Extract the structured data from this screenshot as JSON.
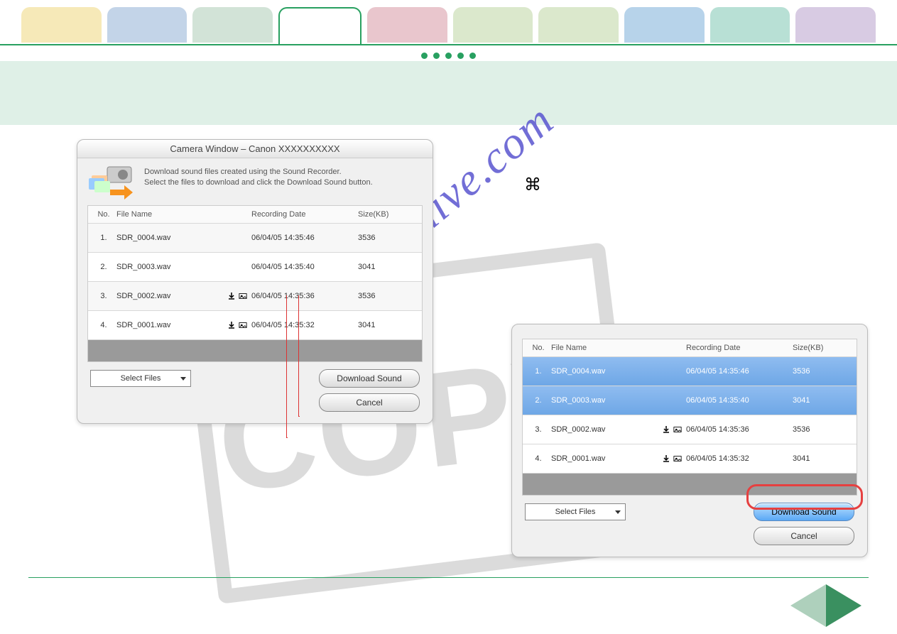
{
  "tabs": {
    "colors": [
      "#f6e9b8",
      "#c3d4e8",
      "#d2e3d7",
      "#ffffff",
      "#e9c6cd",
      "#dbe8cc",
      "#dbe8cc",
      "#b7d3ea",
      "#b8e0d5",
      "#d8cbe3"
    ],
    "activeIndex": 3
  },
  "watermark": {
    "site": "manualshive.com",
    "copy": "COPY"
  },
  "cmdSymbol": "⌘",
  "dialogLeft": {
    "title": "Camera Window – Canon XXXXXXXXXX",
    "intro_line1": "Download sound files created using the Sound Recorder.",
    "intro_line2": "Select the files to download and click the Download Sound button.",
    "columns": {
      "no": "No.",
      "fn": "File Name",
      "dt": "Recording Date",
      "sz": "Size(KB)"
    },
    "rows": [
      {
        "no": "1.",
        "fn": "SDR_0004.wav",
        "dl": false,
        "card": false,
        "dt": "06/04/05 14:35:46",
        "sz": "3536",
        "alt": true
      },
      {
        "no": "2.",
        "fn": "SDR_0003.wav",
        "dl": false,
        "card": false,
        "dt": "06/04/05 14:35:40",
        "sz": "3041",
        "alt": false
      },
      {
        "no": "3.",
        "fn": "SDR_0002.wav",
        "dl": true,
        "card": true,
        "dt": "06/04/05 14:35:36",
        "sz": "3536",
        "alt": true
      },
      {
        "no": "4.",
        "fn": "SDR_0001.wav",
        "dl": true,
        "card": true,
        "dt": "06/04/05 14:35:32",
        "sz": "3041",
        "alt": false
      }
    ],
    "selectFiles": "Select Files",
    "downloadSound": "Download Sound",
    "cancel": "Cancel"
  },
  "dialogRight": {
    "columns": {
      "no": "No.",
      "fn": "File Name",
      "dt": "Recording Date",
      "sz": "Size(KB)"
    },
    "rows": [
      {
        "no": "1.",
        "fn": "SDR_0004.wav",
        "dl": false,
        "card": false,
        "dt": "06/04/05 14:35:46",
        "sz": "3536",
        "sel": true
      },
      {
        "no": "2.",
        "fn": "SDR_0003.wav",
        "dl": false,
        "card": false,
        "dt": "06/04/05 14:35:40",
        "sz": "3041",
        "sel": true
      },
      {
        "no": "3.",
        "fn": "SDR_0002.wav",
        "dl": true,
        "card": true,
        "dt": "06/04/05 14:35:36",
        "sz": "3536",
        "sel": false
      },
      {
        "no": "4.",
        "fn": "SDR_0001.wav",
        "dl": true,
        "card": true,
        "dt": "06/04/05 14:35:32",
        "sz": "3041",
        "sel": false
      }
    ],
    "selectFiles": "Select Files",
    "downloadSound": "Download Sound",
    "cancel": "Cancel"
  }
}
